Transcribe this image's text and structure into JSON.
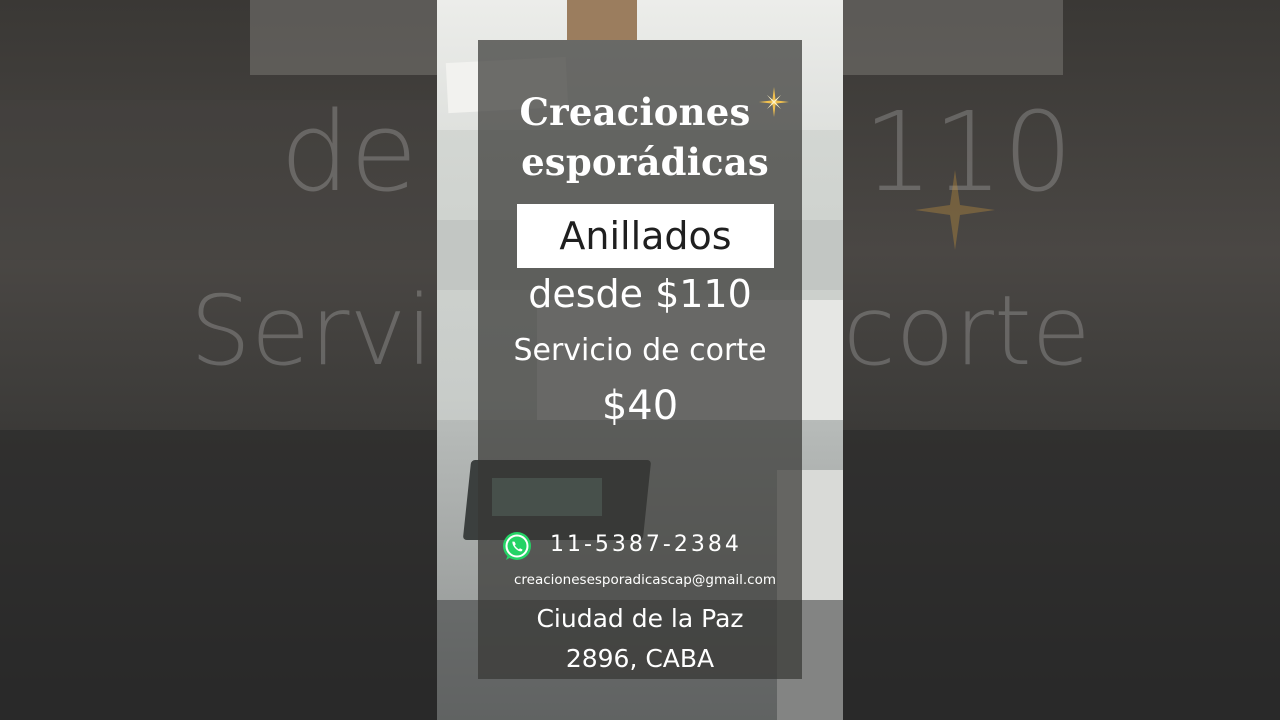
{
  "brand": {
    "line1": "Creaciones",
    "line2": "esporádicas",
    "accent_color": "#f2c14e"
  },
  "offer": {
    "product": "Anillados",
    "product_price": "desde $110",
    "service": "Servicio de corte",
    "service_price": "$40"
  },
  "contact": {
    "icon": "whatsapp-icon",
    "phone": "11-5387-2384",
    "email": "creacionesesporadicascap@gmail.com",
    "address_line1": "Ciudad de la Paz",
    "address_line2": "2896, CABA"
  },
  "background": {
    "ghost_left_top": "de",
    "ghost_left_bottom": "Servi",
    "ghost_right_top": "110",
    "ghost_right_bottom": "corte"
  }
}
